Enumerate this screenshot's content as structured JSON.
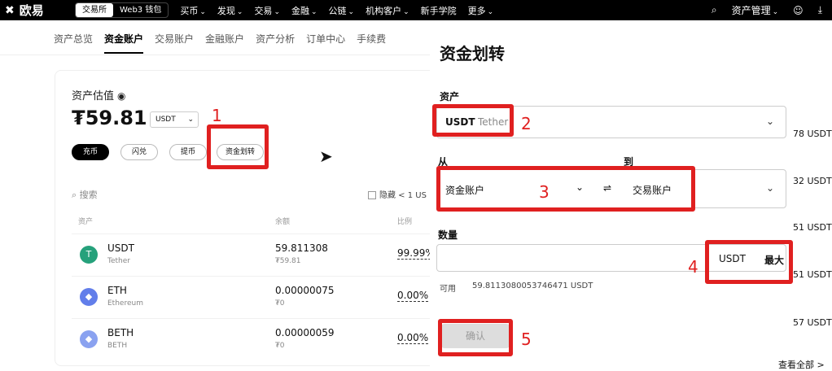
{
  "topnav": {
    "logo": "欧易",
    "tabs": [
      "交易所",
      "Web3 钱包"
    ],
    "items": [
      "买币",
      "发现",
      "交易",
      "金融",
      "公链",
      "机构客户",
      "新手学院",
      "更多"
    ],
    "asset_mgmt": "资产管理"
  },
  "subnav": [
    "资产总览",
    "资金账户",
    "交易账户",
    "金融账户",
    "资产分析",
    "订单中心",
    "手续费"
  ],
  "summary": {
    "label": "资产估值",
    "amount": "₮59.81",
    "unit": "USDT",
    "buttons": [
      "充币",
      "闪兑",
      "提币",
      "资金划转"
    ],
    "search_placeholder": "搜索",
    "hide_label": "隐藏 < 1 US"
  },
  "table": {
    "headers": [
      "资产",
      "余额",
      "比例"
    ],
    "rows": [
      {
        "symbol": "USDT",
        "name": "Tether",
        "balance": "59.811308",
        "fiat": "₮59.81",
        "pct": "99.99%",
        "icon": "tether-icon",
        "color": "#26a17b"
      },
      {
        "symbol": "ETH",
        "name": "Ethereum",
        "balance": "0.00000075",
        "fiat": "₮0",
        "pct": "0.00%",
        "icon": "ethereum-icon",
        "color": "#627eea"
      },
      {
        "symbol": "BETH",
        "name": "BETH",
        "balance": "0.00000059",
        "fiat": "₮0",
        "pct": "0.00%",
        "icon": "beth-icon",
        "color": "#8aa2f0"
      }
    ]
  },
  "modal": {
    "title": "资金划转",
    "asset_label": "资产",
    "asset": "USDT",
    "asset_name": "Tether",
    "from_label": "从",
    "from": "资金账户",
    "to_label": "到",
    "to": "交易账户",
    "qty_label": "数量",
    "qty_unit": "USDT",
    "max": "最大",
    "avail_label": "可用",
    "avail": "59.8113080053746471 USDT",
    "confirm": "确认"
  },
  "annotations": [
    "1",
    "2",
    "3",
    "4",
    "5"
  ],
  "right_values": [
    "78 USDT",
    "32 USDT",
    "51 USDT",
    "51 USDT",
    "57 USDT"
  ],
  "view_all": "查看全部 >"
}
